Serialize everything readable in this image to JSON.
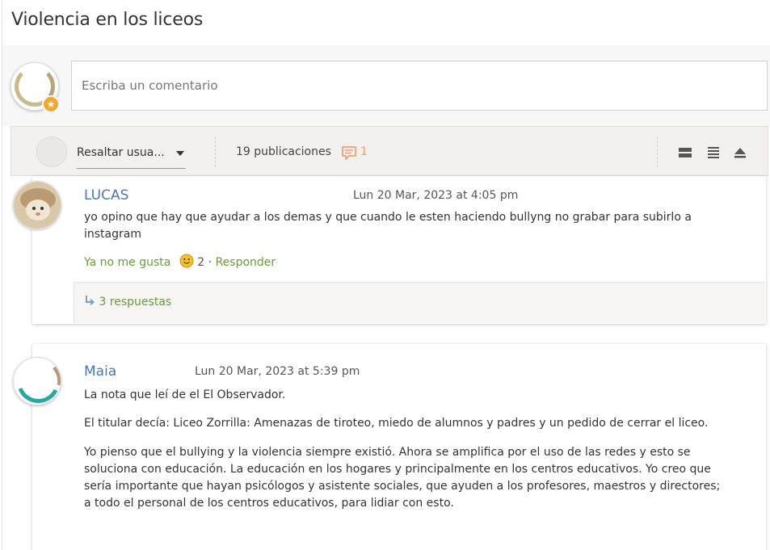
{
  "page": {
    "title": "Violencia en los liceos"
  },
  "compose": {
    "placeholder": "Escriba un comentario"
  },
  "toolbar": {
    "highlight_label": "Resaltar usua...",
    "post_count": "19 publicaciones",
    "comment_count": "1",
    "accent_color": "#f0a070"
  },
  "comments": [
    {
      "author": "LUCAS",
      "date": "Lun 20 Mar, 2023 at 4:05 pm",
      "paragraphs": [
        "yo opino que hay que ayudar a los demas y que cuando le esten haciendo bullyng no grabar para subirlo a instagram"
      ],
      "unlike_label": "Ya no me gusta",
      "reaction_icon": "smiley-face",
      "like_count": "2",
      "separator": "·",
      "reply_label": "Responder",
      "replies_label": "3 respuestas"
    },
    {
      "author": "Maia",
      "date": "Lun 20 Mar, 2023 at 5:39 pm",
      "paragraphs": [
        "La nota que leí de el El Observador.",
        "El titular decía: Liceo Zorrilla: Amenazas de tiroteo, miedo de alumnos y padres y un pedido de cerrar el liceo.",
        "Yo pienso que el bullying y la violencia siempre existió. Ahora se amplifica por el uso de las redes y esto se soluciona con educación. La educación en los hogares y principalmente en los centros educativos. Yo creo que sería importante que hayan psicólogos y asistente sociales, que ayuden a los profesores, maestros y directores; a todo el personal de los centros educativos, para lidiar con esto."
      ]
    }
  ],
  "colors": {
    "link_green": "#6a9a3c",
    "author_blue": "#4a78b0",
    "badge_orange": "#f0a830"
  }
}
